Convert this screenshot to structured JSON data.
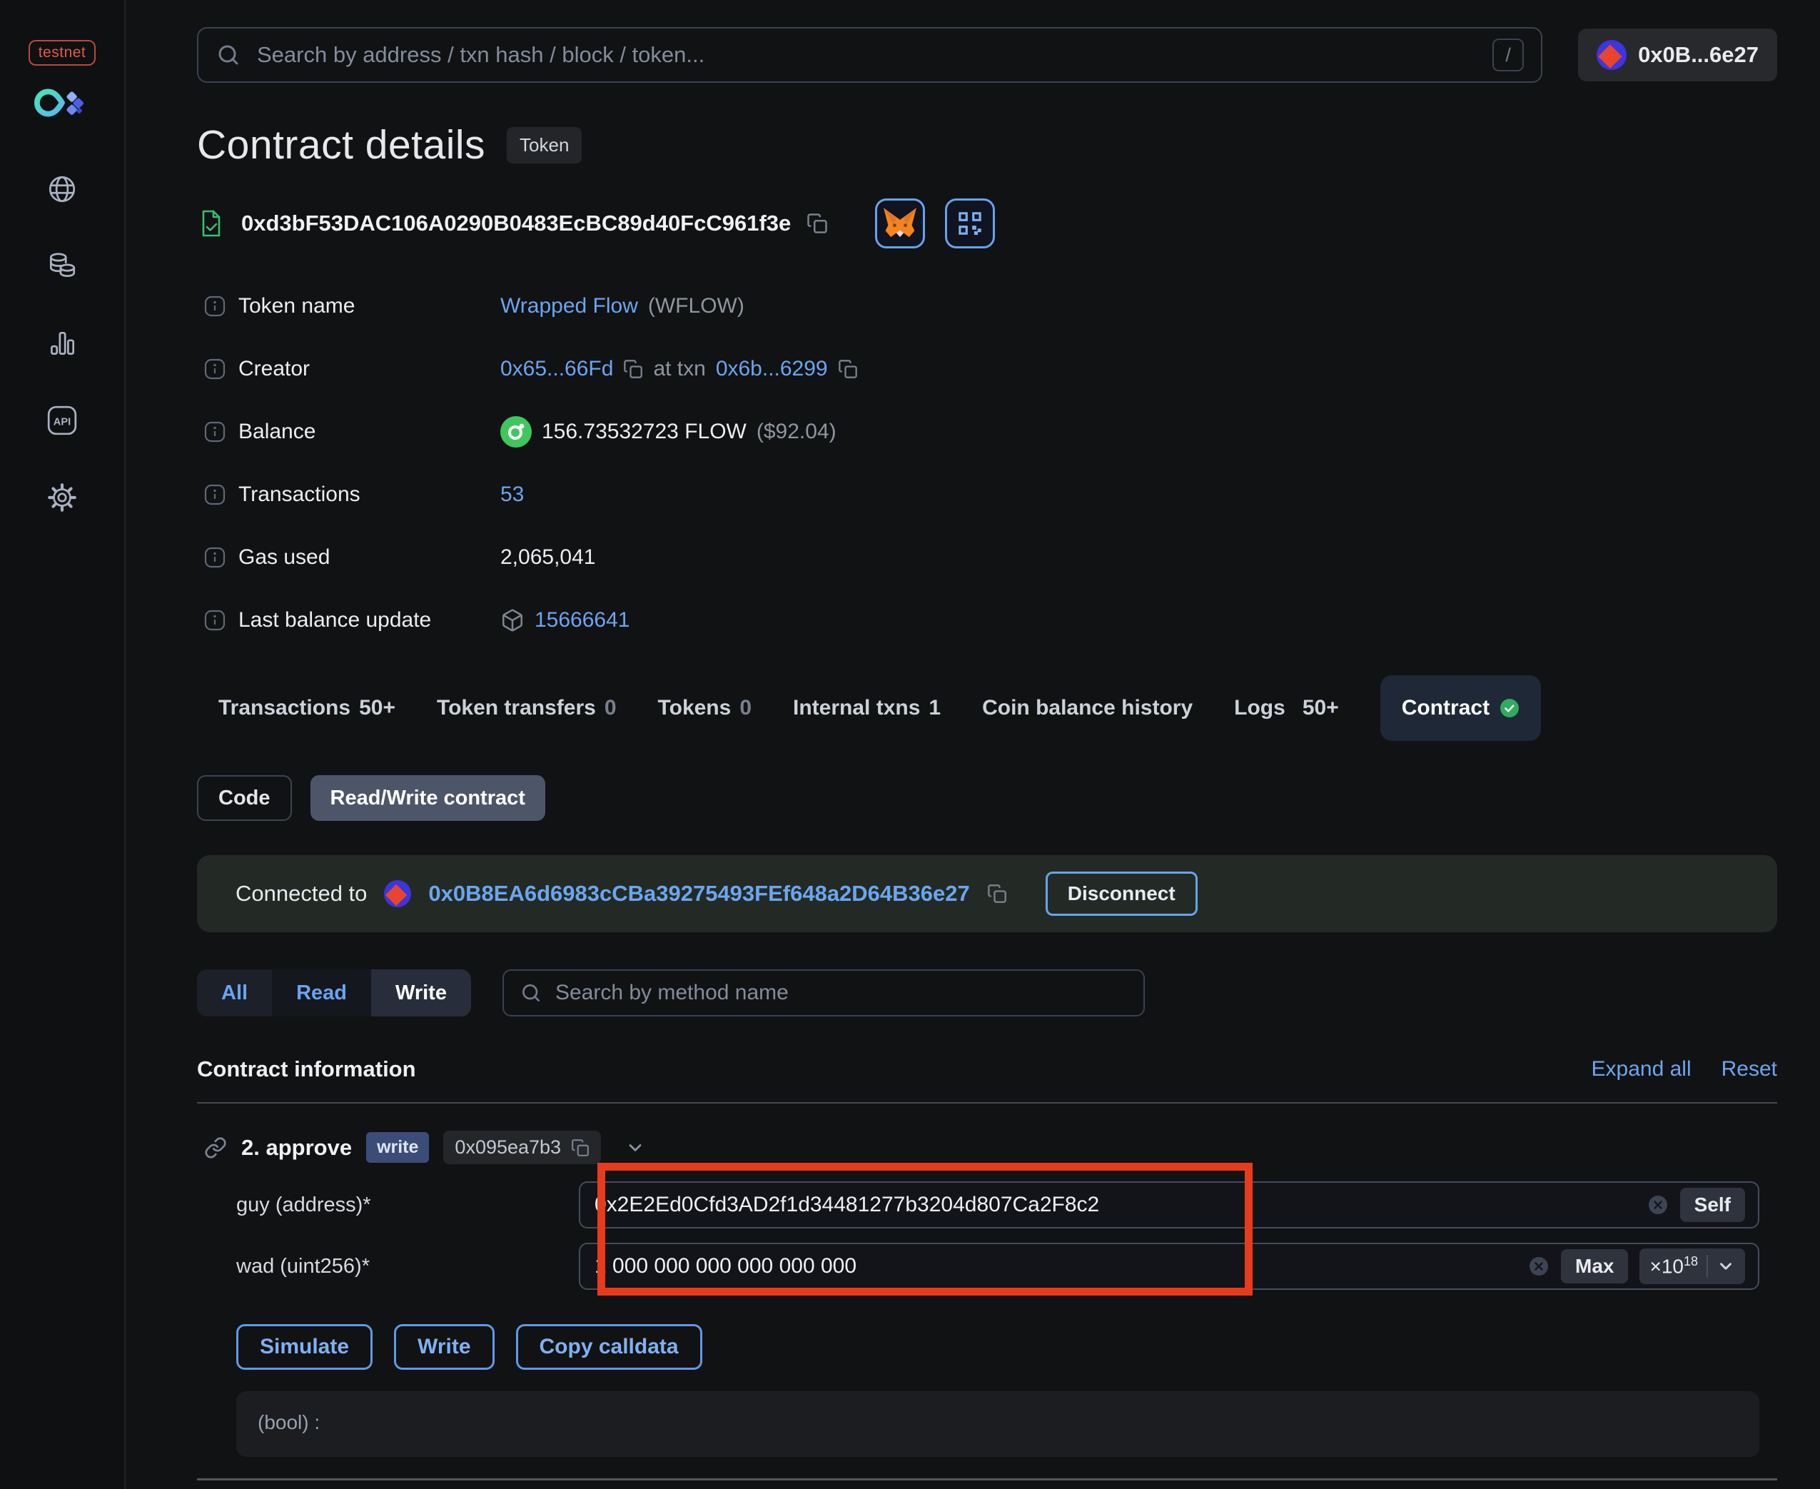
{
  "sidebar": {
    "network_badge": "testnet",
    "api_label": "API",
    "items": [
      "network",
      "tokens",
      "stats",
      "api",
      "settings"
    ]
  },
  "header": {
    "search_placeholder": "Search by address / txn hash / block / token...",
    "shortcut_key": "/",
    "account_label": "0x0B...6e27"
  },
  "contract": {
    "title": "Contract details",
    "type_badge": "Token",
    "address": "0xd3bF53DAC106A0290B0483EcBC89d40FcC961f3e",
    "rows": {
      "token_name": {
        "label": "Token name",
        "link": "Wrapped Flow",
        "symbol": "(WFLOW)"
      },
      "creator": {
        "label": "Creator",
        "address": "0x65...66Fd",
        "at_txn": "at txn",
        "txn": "0x6b...6299"
      },
      "balance": {
        "label": "Balance",
        "value": "156.73532723 FLOW",
        "usd": "($92.04)"
      },
      "transactions": {
        "label": "Transactions",
        "value": "53"
      },
      "gas_used": {
        "label": "Gas used",
        "value": "2,065,041"
      },
      "last_balance_update": {
        "label": "Last balance update",
        "value": "15666641"
      }
    }
  },
  "tabs": {
    "items": [
      {
        "label": "Transactions",
        "count": "50+"
      },
      {
        "label": "Token transfers",
        "count": "0"
      },
      {
        "label": "Tokens",
        "count": "0"
      },
      {
        "label": "Internal txns",
        "count": "1"
      },
      {
        "label": "Coin balance history",
        "count": ""
      },
      {
        "label": "Logs",
        "count": "50+"
      },
      {
        "label": "Contract",
        "count": ""
      }
    ],
    "active": "Contract"
  },
  "contract_subtabs": {
    "code": "Code",
    "read_write": "Read/Write contract"
  },
  "connection": {
    "prefix": "Connected to",
    "address": "0x0B8EA6d6983cCBa39275493FEf648a2D64B36e27",
    "disconnect_label": "Disconnect"
  },
  "methods_filter": {
    "all": "All",
    "read": "Read",
    "write": "Write",
    "selected": "Write",
    "search_placeholder": "Search by method name"
  },
  "section": {
    "title": "Contract information",
    "expand_all": "Expand all",
    "reset": "Reset"
  },
  "method": {
    "name": "2. approve",
    "badge": "write",
    "selector": "0x095ea7b3"
  },
  "form": {
    "guy": {
      "label": "guy (address)*",
      "value": "0x2E2Ed0Cfd3AD2f1d34481277b3204d807Ca2F8c2",
      "self_button": "Self"
    },
    "wad": {
      "label": "wad (uint256)*",
      "value": "1 000 000 000 000 000 000",
      "max_button": "Max",
      "multiplier_base": "×10",
      "multiplier_exp": "18"
    },
    "buttons": {
      "simulate": "Simulate",
      "write": "Write",
      "copy_calldata": "Copy calldata"
    },
    "output_label": "(bool) :"
  },
  "colors": {
    "accent_blue": "#6ba6ef",
    "annotation_red": "#e83b1c",
    "success_green": "#2fac5f",
    "flow_green": "#3fc75e",
    "banner_bg": "#232a25"
  }
}
